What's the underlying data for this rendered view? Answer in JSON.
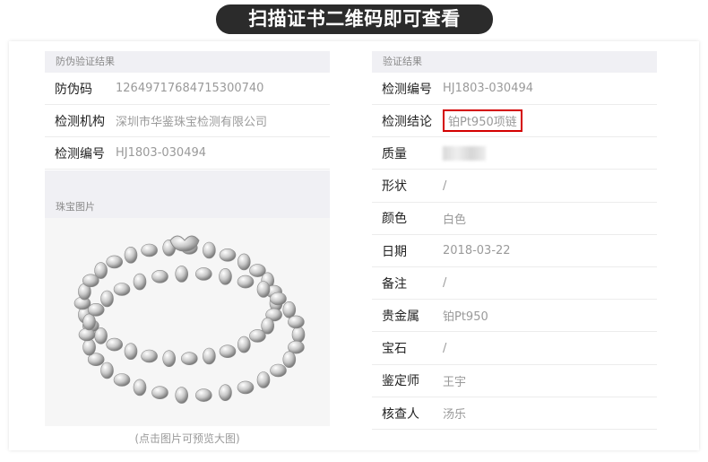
{
  "banner": "扫描证书二维码即可查看",
  "left": {
    "header": "防伪验证结果",
    "rows": [
      {
        "label": "防伪码",
        "value": "12649717684715300740"
      },
      {
        "label": "检测机构",
        "value": "深圳市华鉴珠宝检测有限公司"
      },
      {
        "label": "检测编号",
        "value": "HJ1803-030494"
      }
    ],
    "image_header": "珠宝图片",
    "image_caption": "(点击图片可预览大图)"
  },
  "right": {
    "header": "验证结果",
    "rows": [
      {
        "label": "检测编号",
        "value": "HJ1803-030494"
      },
      {
        "label": "检测结论",
        "value": "铂Pt950项链"
      },
      {
        "label": "质量",
        "value": ""
      },
      {
        "label": "形状",
        "value": "/"
      },
      {
        "label": "颜色",
        "value": "白色"
      },
      {
        "label": "日期",
        "value": "2018-03-22"
      },
      {
        "label": "备注",
        "value": "/"
      },
      {
        "label": "贵金属",
        "value": "铂Pt950"
      },
      {
        "label": "宝石",
        "value": "/"
      },
      {
        "label": "鉴定师",
        "value": "王宇"
      },
      {
        "label": "核查人",
        "value": "汤乐"
      }
    ]
  },
  "colors": {
    "highlight": "#d40000",
    "banner_bg": "#2b2b2b"
  }
}
